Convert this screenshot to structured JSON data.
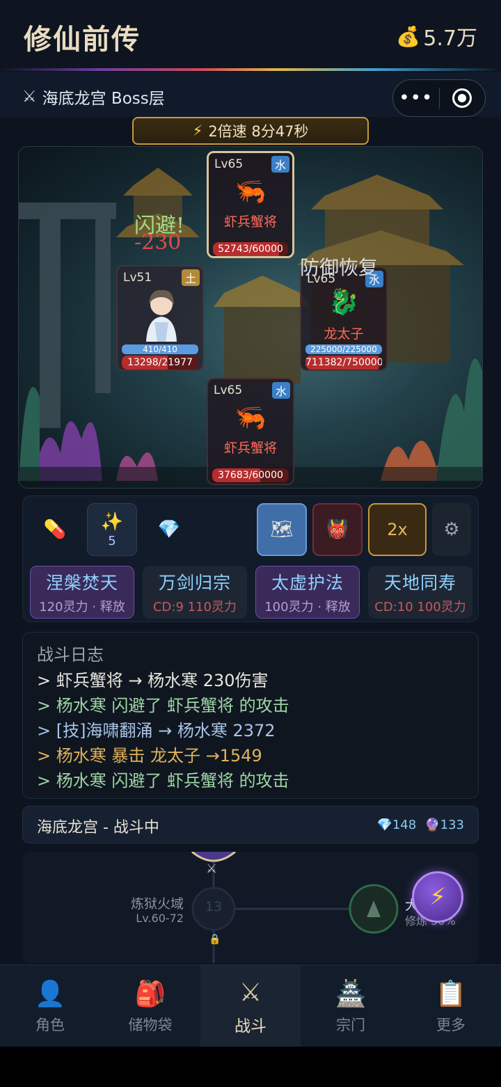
{
  "header": {
    "app_title": "修仙前传",
    "gold_icon": "money-bag-icon",
    "gold": "5.7万"
  },
  "subheader": {
    "stage_icon": "crossed-swords-icon",
    "stage_name": "海底龙宫 Boss层",
    "more_icon": "•••"
  },
  "speed": {
    "icon": "⚡",
    "label": "2倍速 8分47秒"
  },
  "battle": {
    "enemies": [
      {
        "level": "Lv65",
        "element": "水",
        "name": "虾兵蟹将",
        "icon": "shrimp-icon",
        "hp_text": "52743/60000",
        "hp_ratio": 0.879
      },
      {
        "level": "Lv65",
        "element": "水",
        "name": "龙太子",
        "icon": "dragon-icon",
        "mp_text": "225000/225000",
        "mp_ratio": 1.0,
        "hp_text": "711382/750000",
        "hp_ratio": 0.948
      },
      {
        "level": "Lv65",
        "element": "水",
        "name": "虾兵蟹将",
        "icon": "shrimp-icon",
        "hp_text": "37683/60000",
        "hp_ratio": 0.628
      }
    ],
    "player": {
      "level": "Lv51",
      "element": "土",
      "name": "杨水寒",
      "mp_text": "410/410",
      "mp_ratio": 1.0,
      "hp_text": "13298/21977",
      "hp_ratio": 0.605
    },
    "float_dodge": "闪避!",
    "float_damage": "-230",
    "float_defense": "防御恢复"
  },
  "items": [
    {
      "icon": "pill-icon",
      "glyph": "💊",
      "count": ""
    },
    {
      "icon": "sparkle-icon",
      "glyph": "✨",
      "count": "5"
    },
    {
      "icon": "diamond-icon",
      "glyph": "💎",
      "count": ""
    }
  ],
  "tools": [
    {
      "icon": "map-icon",
      "glyph": "🗺",
      "label": ""
    },
    {
      "icon": "demon-icon",
      "glyph": "👹",
      "label": ""
    },
    {
      "icon": "speed-icon",
      "glyph": "",
      "label": "2x"
    },
    {
      "icon": "gear-icon",
      "glyph": "⚙",
      "label": ""
    }
  ],
  "skills": [
    {
      "name": "涅槃焚天",
      "desc": "120灵力 · 释放"
    },
    {
      "name": "万剑归宗",
      "desc": "CD:9  110灵力"
    },
    {
      "name": "太虚护法",
      "desc": "100灵力 · 释放"
    },
    {
      "name": "天地同寿",
      "desc": "CD:10  100灵力"
    }
  ],
  "log": {
    "title": "战斗日志",
    "lines": [
      "> 虾兵蟹将 → 杨水寒 230伤害",
      "> 杨水寒 闪避了 虾兵蟹将 的攻击",
      "> [技]海啸翻涌 → 杨水寒 2372",
      "> 杨水寒 暴击 龙太子 →1549",
      "> 杨水寒 闪避了 虾兵蟹将 的攻击"
    ]
  },
  "status": {
    "text": "海底龙宫 - 战斗中",
    "diamonds": "💎148",
    "orbs": "🔮133"
  },
  "map": {
    "node_name": "炼狱火域",
    "node_level": "Lv.60-72",
    "node_number": "13",
    "right_label": "大",
    "right_sub": "修炼 50%"
  },
  "fab_icon": "⚡",
  "tabs": [
    {
      "icon": "👤",
      "label": "角色"
    },
    {
      "icon": "🎒",
      "label": "储物袋"
    },
    {
      "icon": "⚔",
      "label": "战斗"
    },
    {
      "icon": "🏯",
      "label": "宗门"
    },
    {
      "icon": "📋",
      "label": "更多"
    }
  ]
}
